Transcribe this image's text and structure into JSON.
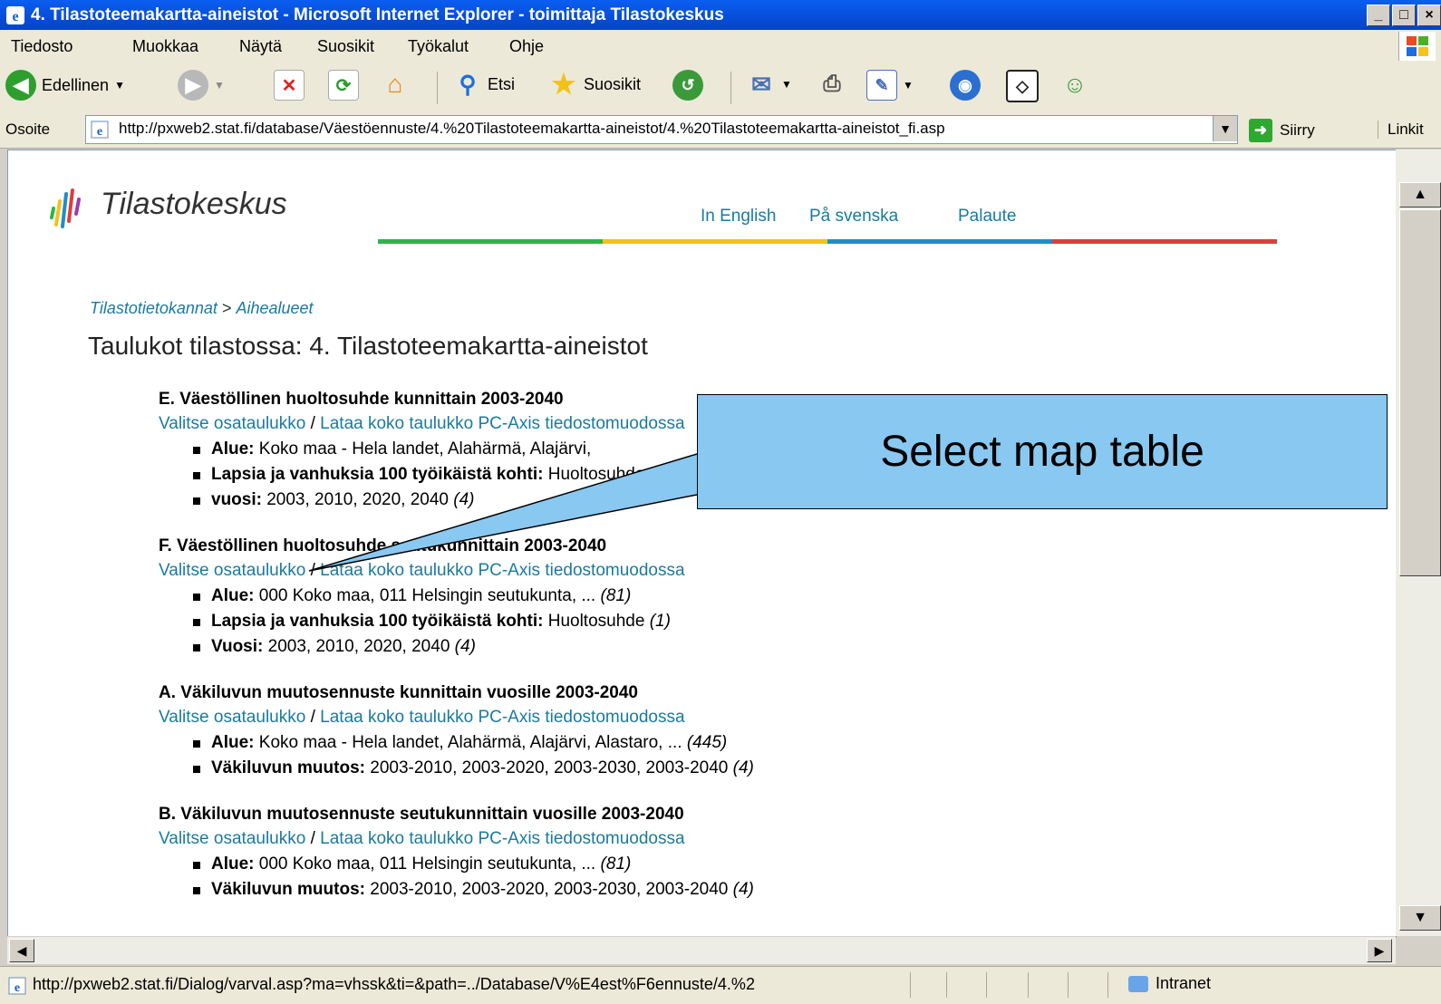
{
  "window": {
    "title": "4. Tilastoteemakartta-aineistot - Microsoft Internet Explorer - toimittaja Tilastokeskus",
    "controls": [
      "_",
      "□",
      "×"
    ]
  },
  "menu": {
    "items": [
      "Tiedosto",
      "Muokkaa",
      "Näytä",
      "Suosikit",
      "Työkalut",
      "Ohje"
    ]
  },
  "toolbar": {
    "back": "Edellinen",
    "search": "Etsi",
    "favorites": "Suosikit"
  },
  "address": {
    "label": "Osoite",
    "url": "http://pxweb2.stat.fi/database/Väestöennuste/4.%20Tilastoteemakartta-aineistot/4.%20Tilastoteemakartta-aineistot_fi.asp",
    "go": "Siirry",
    "links": "Linkit"
  },
  "page": {
    "logo_text": "Tilastokeskus",
    "top_links": [
      "In English",
      "På svenska",
      "Palaute"
    ],
    "breadcrumb": {
      "first": "Tilastotietokannat",
      "sep": " > ",
      "second": "Aihealueet"
    },
    "heading": "Taulukot tilastossa: 4. Tilastoteemakartta-aineistot",
    "sections": [
      {
        "title": "E. Väestöllinen huoltosuhde kunnittain 2003-2040",
        "link1": "Valitse osataulukko",
        "link2": "Lataa koko taulukko PC-Axis tiedostomuodossa",
        "items": [
          {
            "label": "Alue:",
            "value": " Koko maa - Hela landet, Alahärmä, Alajärvi,",
            "count": ""
          },
          {
            "label": "Lapsia ja vanhuksia 100 työikäistä kohti:",
            "value": " Huoltosuhde",
            "count": ""
          },
          {
            "label": "vuosi:",
            "value": " 2003, 2010, 2020, 2040 ",
            "count": "(4)"
          }
        ]
      },
      {
        "title": "F. Väestöllinen huoltosuhde seutukunnittain 2003-2040",
        "link1": "Valitse osataulukko",
        "link2": "Lataa koko taulukko PC-Axis tiedostomuodossa",
        "items": [
          {
            "label": "Alue:",
            "value": " 000 Koko maa, 011 Helsingin seutukunta, ... ",
            "count": "(81)"
          },
          {
            "label": "Lapsia ja vanhuksia 100 työikäistä kohti:",
            "value": " Huoltosuhde ",
            "count": "(1)"
          },
          {
            "label": "Vuosi:",
            "value": " 2003, 2010, 2020, 2040 ",
            "count": "(4)"
          }
        ]
      },
      {
        "title": "A. Väkiluvun muutosennuste kunnittain vuosille 2003-2040",
        "link1": "Valitse osataulukko",
        "link2": "Lataa koko taulukko PC-Axis tiedostomuodossa",
        "items": [
          {
            "label": "Alue:",
            "value": " Koko maa - Hela landet, Alahärmä, Alajärvi, Alastaro, ... ",
            "count": "(445)"
          },
          {
            "label": "Väkiluvun muutos:",
            "value": " 2003-2010, 2003-2020, 2003-2030, 2003-2040 ",
            "count": "(4)"
          }
        ]
      },
      {
        "title": "B. Väkiluvun muutosennuste seutukunnittain vuosille 2003-2040",
        "link1": "Valitse osataulukko",
        "link2": "Lataa koko taulukko PC-Axis tiedostomuodossa",
        "items": [
          {
            "label": "Alue:",
            "value": " 000 Koko maa, 011 Helsingin seutukunta, ... ",
            "count": "(81)"
          },
          {
            "label": "Väkiluvun muutos:",
            "value": " 2003-2010, 2003-2020, 2003-2030, 2003-2040 ",
            "count": "(4)"
          }
        ]
      }
    ]
  },
  "callout": {
    "text": "Select map table"
  },
  "status": {
    "text": "http://pxweb2.stat.fi/Dialog/varval.asp?ma=vhssk&ti=&path=../Database/V%E4est%F6ennuste/4.%2",
    "zone": "Intranet"
  },
  "colors": {
    "accent_link": "#1a7aa0",
    "callout_fill": "#89c8f0",
    "bar_green": "#2fb34a",
    "bar_yellow": "#f2c21a",
    "bar_blue": "#1e8ec8",
    "bar_red": "#e03c3c"
  }
}
